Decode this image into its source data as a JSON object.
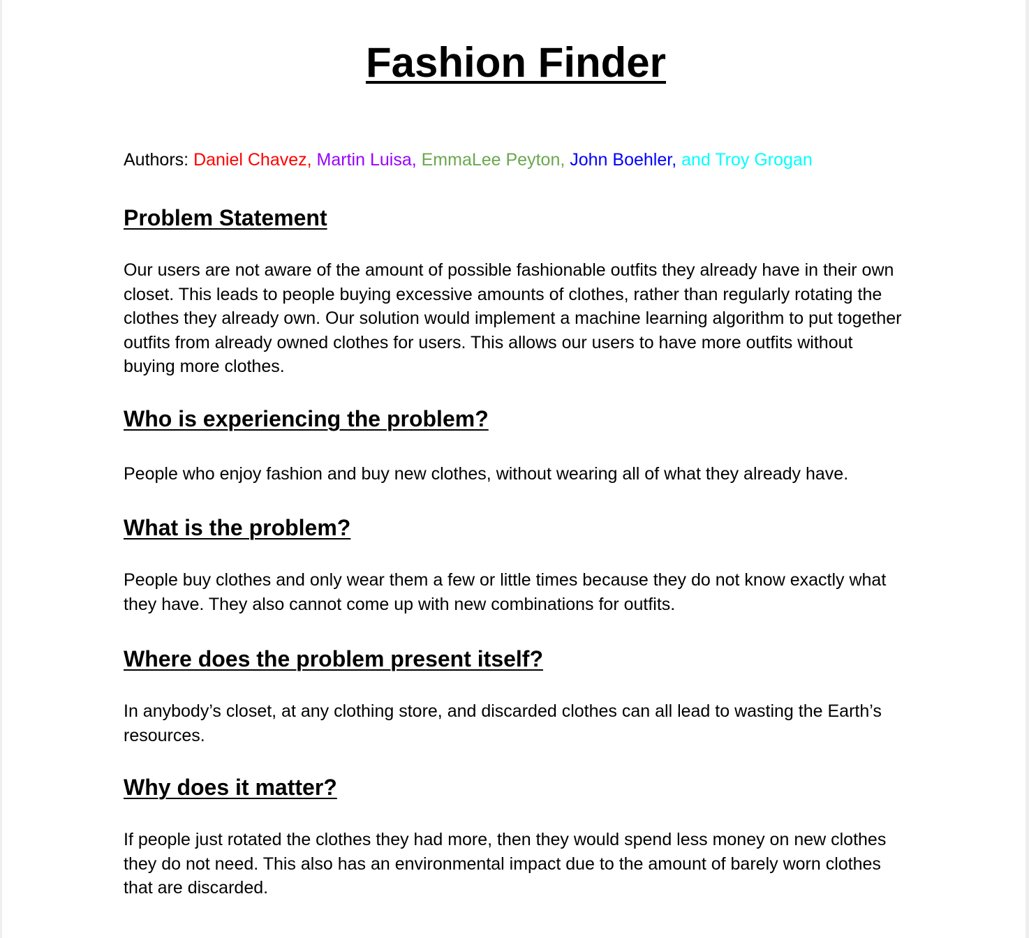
{
  "document": {
    "title": "Fashion Finder",
    "authors": {
      "label": "Authors: ",
      "names": [
        {
          "text": "Daniel Chavez,",
          "color": "#ff0000"
        },
        {
          "text": "Martin Luisa,",
          "color": "#9900ff"
        },
        {
          "text": "EmmaLee Peyton,",
          "color": "#6aa84f"
        },
        {
          "text": "John Boehler,",
          "color": "#0000ff"
        },
        {
          "text": "and Troy Grogan",
          "color": "#00ffff"
        }
      ]
    },
    "sections": [
      {
        "heading": "Problem Statement",
        "body": "Our users are not aware of the amount of possible fashionable outfits they already have in their own closet. This leads to people buying excessive amounts of clothes, rather than regularly rotating the clothes they already own. Our solution would implement a machine learning algorithm to put together outfits from already owned clothes for users. This allows our users to have more outfits without buying more clothes."
      },
      {
        "heading": "Who is experiencing the problem?",
        "body": "People who enjoy fashion and buy new clothes, without wearing all of what they already have."
      },
      {
        "heading": "What is the problem?",
        "body": "People buy clothes and only wear them a few or little times because they do not know exactly what they have. They also cannot come up with new combinations for outfits."
      },
      {
        "heading": "Where does the problem present itself?",
        "body": "In anybody’s closet, at any clothing store, and discarded clothes can all lead to wasting the Earth’s resources."
      },
      {
        "heading": "Why does it matter?",
        "body": "If people just rotated the clothes they had more, then they would spend less money on new clothes they do not need. This also has an environmental impact due to the amount of barely worn clothes that are discarded."
      }
    ]
  }
}
